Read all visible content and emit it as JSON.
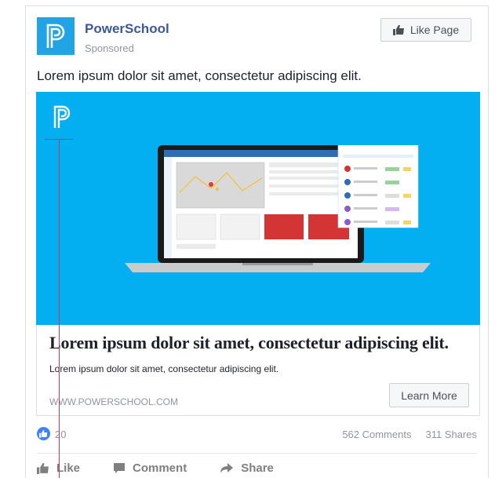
{
  "post": {
    "page_name": "PowerSchool",
    "sponsored_label": "Sponsored",
    "like_page_label": "Like Page",
    "text": "Lorem ipsum dolor sit amet, consectetur adipiscing elit."
  },
  "link": {
    "headline": "Lorem ipsum dolor sit amet, consectetur adipiscing elit.",
    "description": "Lorem ipsum dolor sit amet, consectetur adipiscing elit.",
    "domain": "WWW.POWERSCHOOL.COM",
    "cta_label": "Learn More"
  },
  "stats": {
    "reactions_count": "20",
    "comments": "562 Comments",
    "shares": "311 Shares"
  },
  "actions": {
    "like_label": "Like",
    "comment_label": "Comment",
    "share_label": "Share"
  },
  "colors": {
    "brand_blue": "#21a4e6",
    "media_background": "#03aff1",
    "link_blue": "#3b5998",
    "reaction_blue": "#4080ff"
  },
  "icons": [
    "powerschool-logo-icon",
    "thumbs-up-icon",
    "comment-icon",
    "share-icon",
    "like-reaction-icon"
  ]
}
